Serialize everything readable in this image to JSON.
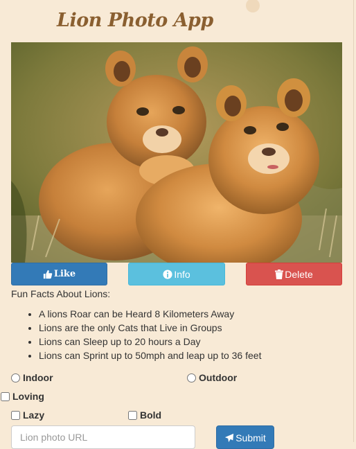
{
  "app": {
    "title": "Lion Photo App"
  },
  "photo": {
    "subject": "two lion cubs"
  },
  "actions": {
    "like_label": "Like",
    "info_label": "Info",
    "delete_label": "Delete",
    "like_icon": "thumbs-up-icon",
    "info_icon": "info-circle-icon",
    "delete_icon": "trash-icon"
  },
  "facts": {
    "heading": "Fun Facts About Lions:",
    "items": [
      "A lions Roar can be Heard 8 Kilometers Away",
      "Lions are the only Cats that Live in Groups",
      "Lions can Sleep up to 20 hours a Day",
      "Lions can Sprint up to 50mph and leap up to 36 feet"
    ]
  },
  "form": {
    "radio_indoor": "Indoor",
    "radio_outdoor": "Outdoor",
    "check_loving": "Loving",
    "check_lazy": "Lazy",
    "check_bold": "Bold",
    "url_placeholder": "Lion photo URL",
    "submit_label": "Submit",
    "submit_icon": "paper-plane-icon"
  },
  "colors": {
    "background": "#f8ead6",
    "title": "#8a5f30",
    "primary": "#337ab7",
    "info": "#5bc0de",
    "danger": "#d9534f"
  }
}
